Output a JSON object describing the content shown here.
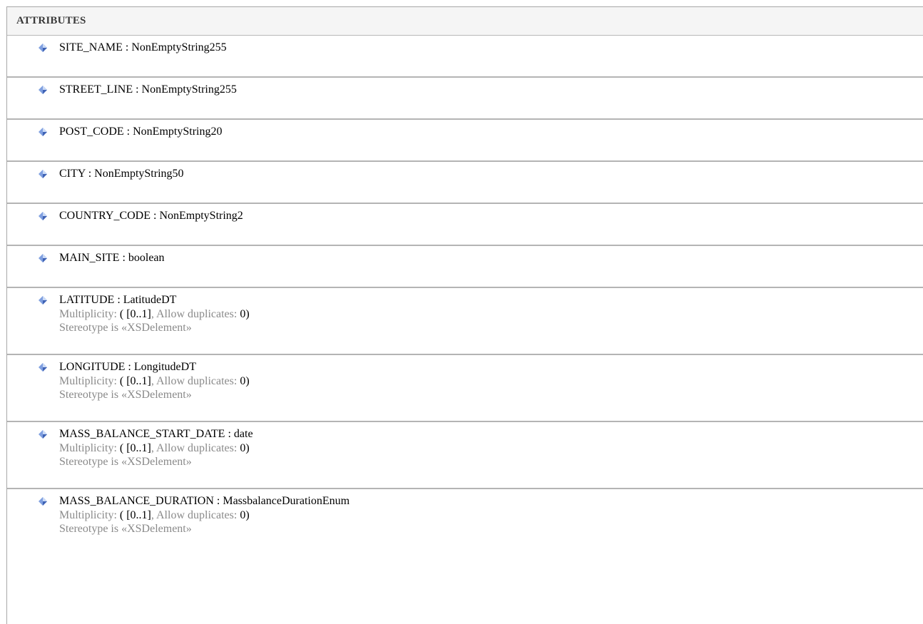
{
  "header": {
    "title": "ATTRIBUTES"
  },
  "attributes": [
    {
      "name": "SITE_NAME : NonEmptyString255"
    },
    {
      "name": "STREET_LINE : NonEmptyString255"
    },
    {
      "name": "POST_CODE : NonEmptyString20"
    },
    {
      "name": "CITY : NonEmptyString50"
    },
    {
      "name": "COUNTRY_CODE : NonEmptyString2"
    },
    {
      "name": "MAIN_SITE : boolean"
    },
    {
      "name": "LATITUDE : LatitudeDT",
      "multiplicity_label": "Multiplicity:",
      "multiplicity_open": "(",
      "multiplicity_value": "[0..1]",
      "allow_dup_label": ", Allow duplicates:",
      "allow_dup_value": "0)",
      "stereotype": "Stereotype is «XSDelement»"
    },
    {
      "name": "LONGITUDE : LongitudeDT",
      "multiplicity_label": "Multiplicity:",
      "multiplicity_open": "(",
      "multiplicity_value": "[0..1]",
      "allow_dup_label": ", Allow duplicates:",
      "allow_dup_value": "0)",
      "stereotype": "Stereotype is «XSDelement»"
    },
    {
      "name": "MASS_BALANCE_START_DATE : date",
      "multiplicity_label": "Multiplicity:",
      "multiplicity_open": "(",
      "multiplicity_value": "[0..1]",
      "allow_dup_label": ", Allow duplicates:",
      "allow_dup_value": "0)",
      "stereotype": "Stereotype is «XSDelement»"
    },
    {
      "name": "MASS_BALANCE_DURATION : MassbalanceDurationEnum",
      "multiplicity_label": "Multiplicity:",
      "multiplicity_open": "(",
      "multiplicity_value": "[0..1]",
      "allow_dup_label": ", Allow duplicates:",
      "allow_dup_value": "0)",
      "stereotype": "Stereotype is «XSDelement»"
    }
  ],
  "colors": {
    "icon_light": "#c9d9f5",
    "icon_dark": "#3f63b5",
    "icon_mid": "#7f9fe0"
  },
  "icon_name": "attribute-diamond-icon"
}
